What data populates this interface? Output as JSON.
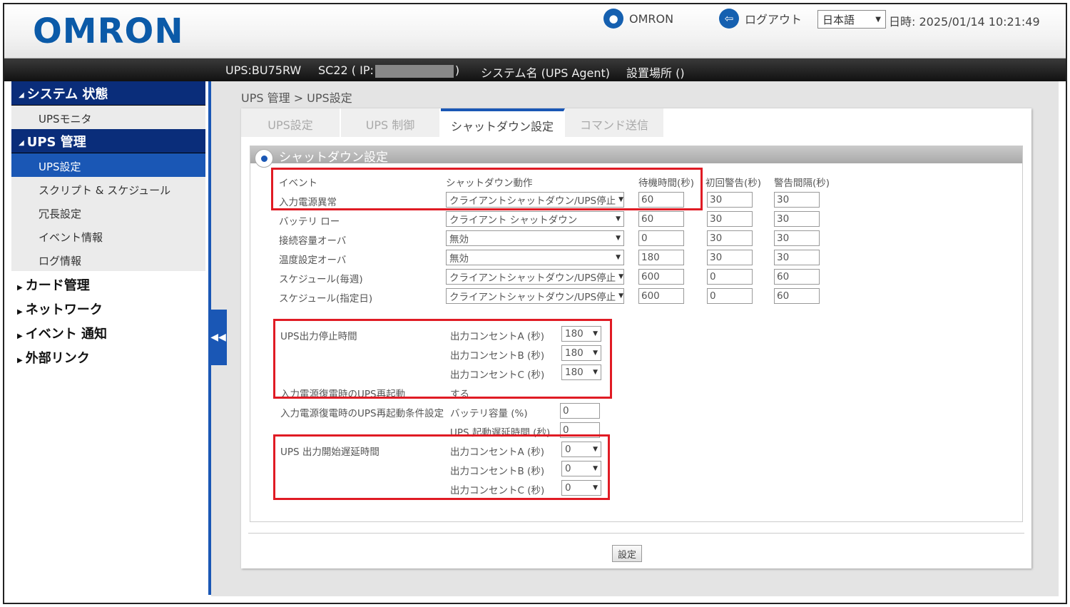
{
  "header": {
    "logo": "OMRON",
    "user": "OMRON",
    "logout": "ログアウト",
    "language": "日本語",
    "datetime": "日時: 2025/01/14 10:21:49"
  },
  "infobar": {
    "ups": "UPS:BU75RW",
    "sc_prefix": "SC22 ( IP:",
    "sc_suffix": ")",
    "system_name": "システム名 (UPS Agent)",
    "location": "設置場所 ()"
  },
  "sidebar": {
    "system_status": "システム 状態",
    "ups_monitor": "UPSモニタ",
    "ups_management": "UPS 管理",
    "items": [
      "UPS設定",
      "スクリプト & スケジュール",
      "冗長設定",
      "イベント情報",
      "ログ情報"
    ],
    "categories": [
      "カード管理",
      "ネットワーク",
      "イベント 通知",
      "外部リンク"
    ]
  },
  "breadcrumb": "UPS 管理 > UPS設定",
  "tabs": [
    "UPS設定",
    "UPS 制御",
    "シャットダウン設定",
    "コマンド送信"
  ],
  "section_title": "シャットダウン設定",
  "table": {
    "headers": [
      "イベント",
      "シャットダウン動作",
      "待機時間(秒)",
      "初回警告(秒)",
      "警告間隔(秒)"
    ],
    "rows": [
      {
        "event": "入力電源異常",
        "action": "クライアントシャットダウン/UPS停止",
        "wait": "60",
        "first": "30",
        "interval": "30"
      },
      {
        "event": "バッテリ ロー",
        "action": "クライアント シャットダウン",
        "wait": "60",
        "first": "30",
        "interval": "30"
      },
      {
        "event": "接続容量オーバ",
        "action": "無効",
        "wait": "0",
        "first": "30",
        "interval": "30"
      },
      {
        "event": "温度設定オーバ",
        "action": "無効",
        "wait": "180",
        "first": "30",
        "interval": "30"
      },
      {
        "event": "スケジュール(毎週)",
        "action": "クライアントシャットダウン/UPS停止",
        "wait": "600",
        "first": "0",
        "interval": "60"
      },
      {
        "event": "スケジュール(指定日)",
        "action": "クライアントシャットダウン/UPS停止",
        "wait": "600",
        "first": "0",
        "interval": "60"
      }
    ]
  },
  "stop_time": {
    "label": "UPS出力停止時間",
    "outlets": [
      {
        "label": "出力コンセントA (秒)",
        "value": "180"
      },
      {
        "label": "出力コンセントB (秒)",
        "value": "180"
      },
      {
        "label": "出力コンセントC (秒)",
        "value": "180"
      }
    ]
  },
  "restart": {
    "label": "入力電源復電時のUPS再起動",
    "value": "する"
  },
  "restart_cond": {
    "label": "入力電源復電時のUPS再起動条件設定",
    "battery_label": "バッテリ容量 (%)",
    "battery_value": "0",
    "delay_label": "UPS 起動遅延時間 (秒)",
    "delay_value": "0"
  },
  "start_delay": {
    "label": "UPS 出力開始遅延時間",
    "outlets": [
      {
        "label": "出力コンセントA (秒)",
        "value": "0"
      },
      {
        "label": "出力コンセントB (秒)",
        "value": "0"
      },
      {
        "label": "出力コンセントC (秒)",
        "value": "0"
      }
    ]
  },
  "set_button": "設定"
}
